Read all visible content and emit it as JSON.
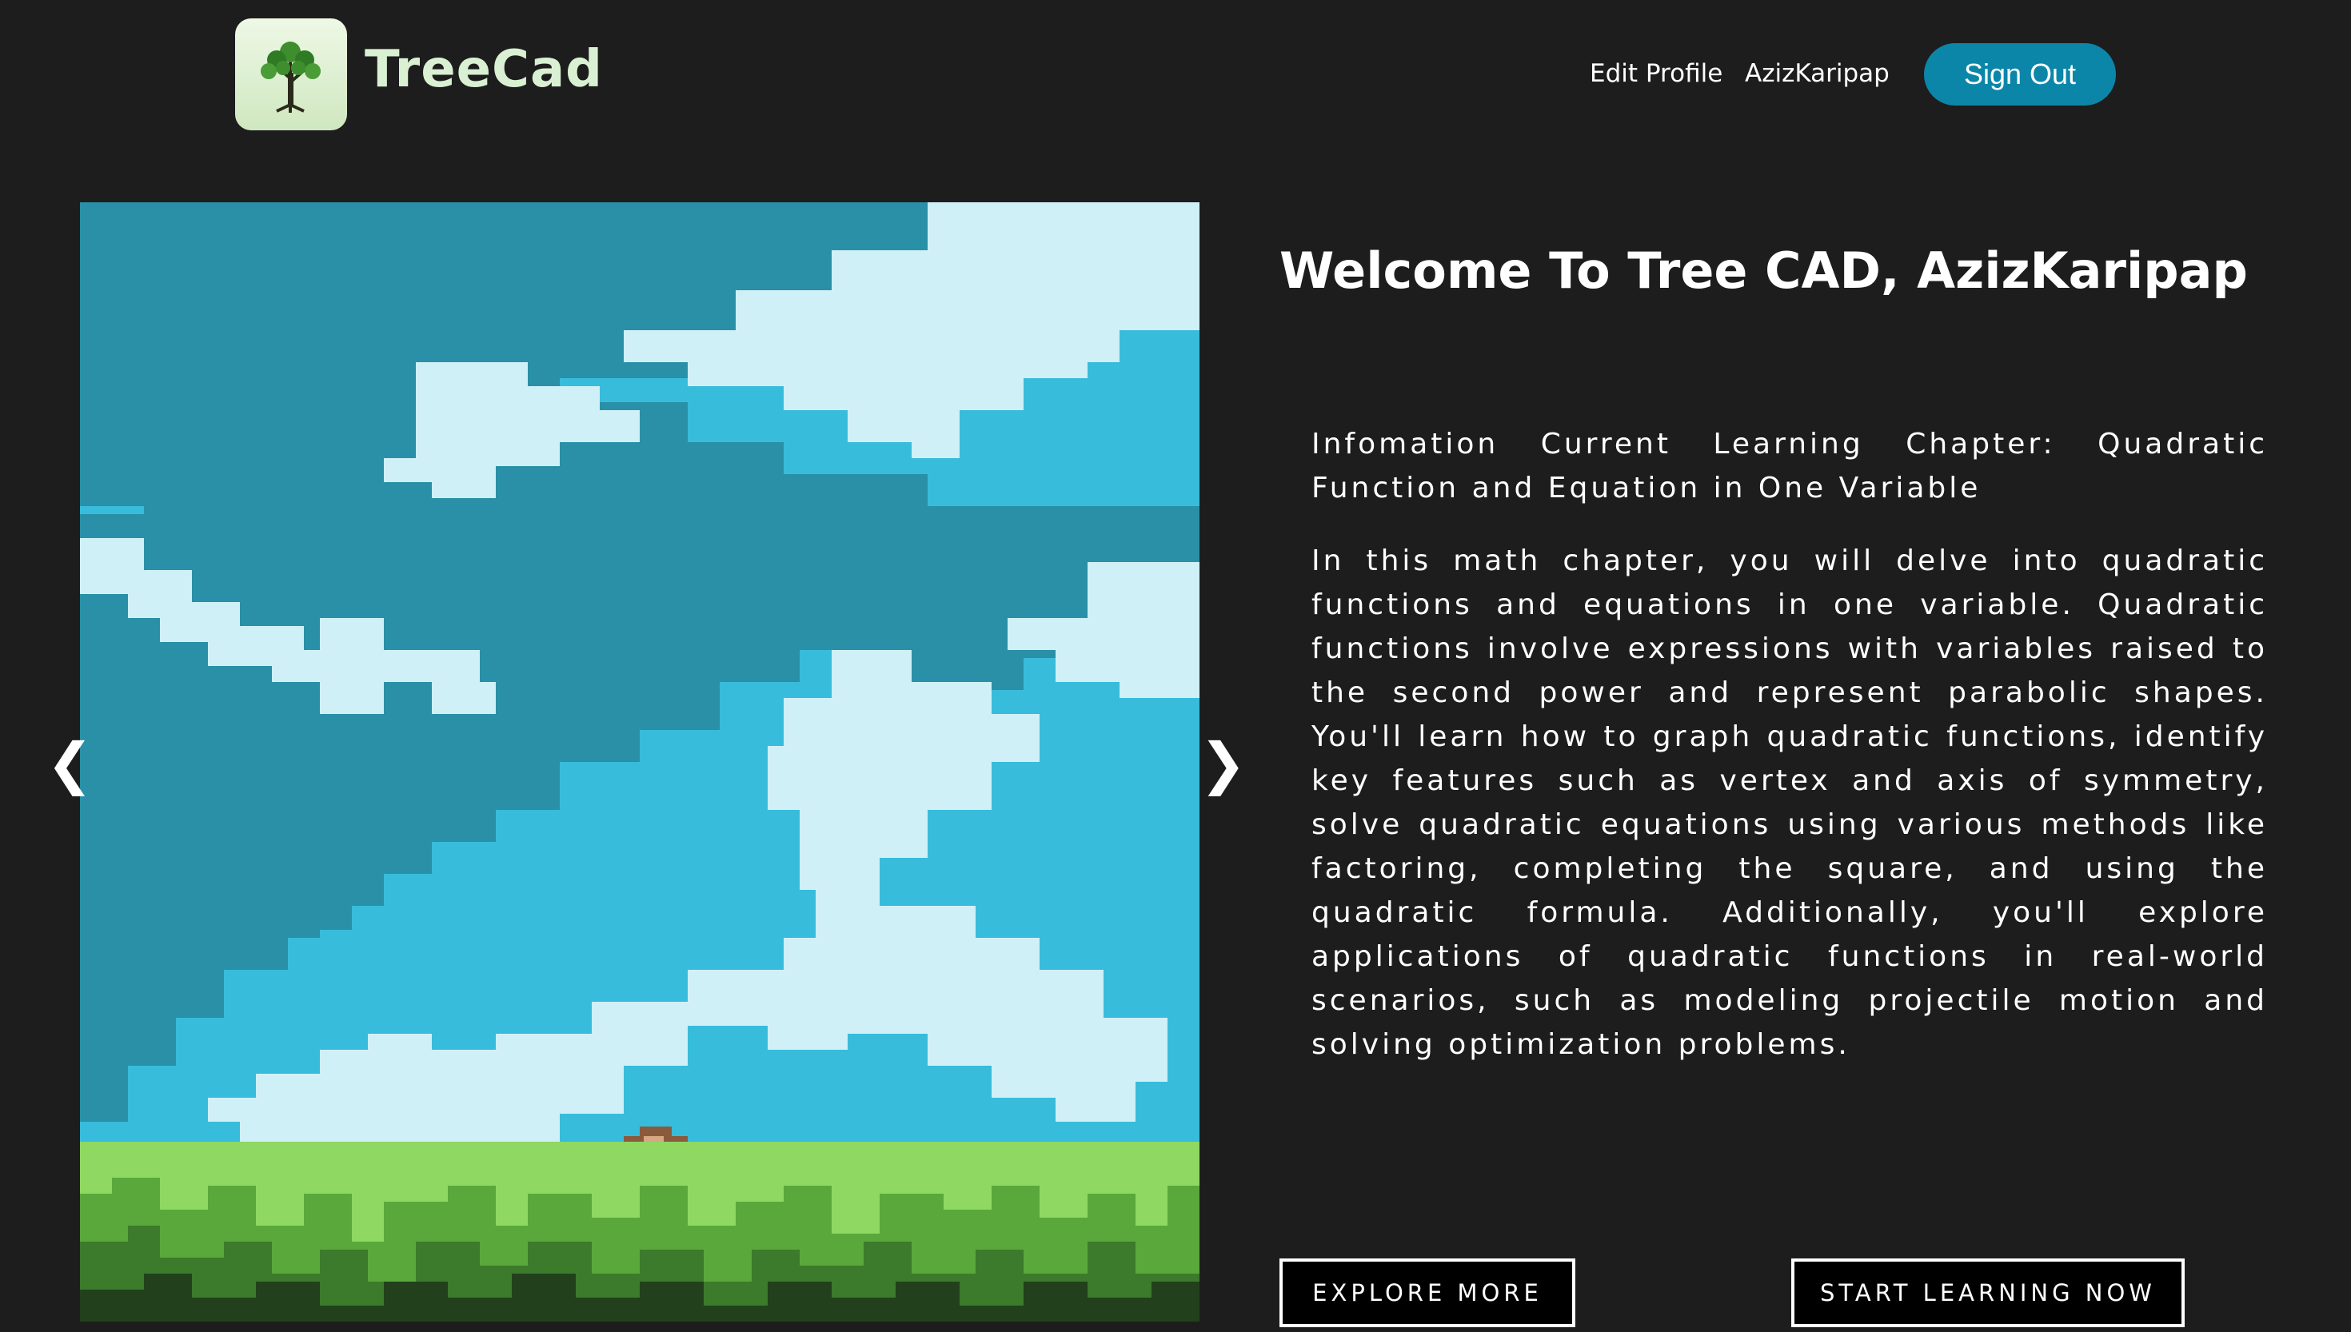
{
  "header": {
    "brand": "TreeCad",
    "logo_icon": "tree-icon",
    "nav": {
      "edit_profile": "Edit Profile",
      "username": "AzizKaripap",
      "sign_out": "Sign Out"
    },
    "accent_color": "#0c86a8"
  },
  "carousel": {
    "prev": "❮",
    "next": "❯",
    "slide_description": "pixel-art-sky-grass"
  },
  "main": {
    "welcome": "Welcome To Tree CAD, AzizKaripap",
    "chapter_info": "Infomation Current Learning Chapter: Quadratic Function and Equation in One Variable",
    "description": "In this math chapter, you will delve into quadratic functions and equations in one variable. Quadratic functions involve expressions with variables raised to the second power and represent parabolic shapes. You'll learn how to graph quadratic functions, identify key features such as vertex and axis of symmetry, solve quadratic equations using various methods like factoring, completing the square, and using the quadratic formula. Additionally, you'll explore applications of quadratic functions in real-world scenarios, such as modeling projectile motion and solving optimization problems.",
    "explore_more": "EXPLORE MORE",
    "start_learning": "START LEARNING NOW"
  }
}
